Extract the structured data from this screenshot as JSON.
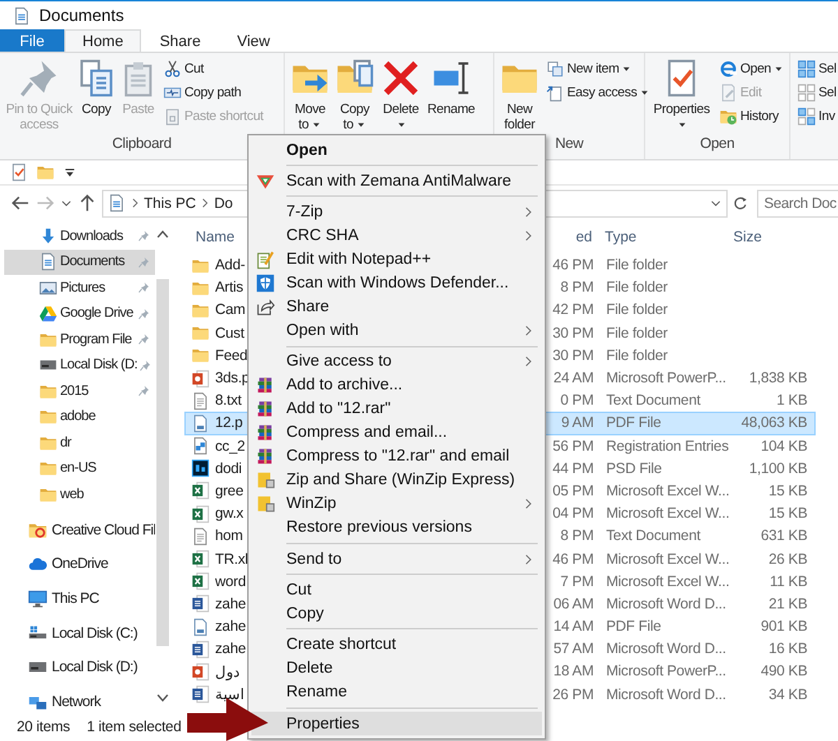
{
  "window": {
    "title": "Documents"
  },
  "ribbon_tabs": [
    {
      "label": "File",
      "kind": "file",
      "selected": false
    },
    {
      "label": "Home",
      "kind": "tab",
      "selected": true
    },
    {
      "label": "Share",
      "kind": "tab",
      "selected": false
    },
    {
      "label": "View",
      "kind": "tab",
      "selected": false
    }
  ],
  "ribbon_groups": [
    {
      "label": "Clipboard",
      "items": [
        {
          "kind": "large",
          "label": "Pin to Quick access",
          "disabled": true,
          "dropdown": false
        },
        {
          "kind": "large",
          "label": "Copy",
          "disabled": false,
          "dropdown": false
        },
        {
          "kind": "large",
          "label": "Paste",
          "disabled": true,
          "dropdown": false
        },
        {
          "kind": "stack",
          "items": [
            {
              "label": "Cut",
              "disabled": false,
              "dropdown": false
            },
            {
              "label": "Copy path",
              "disabled": false,
              "dropdown": false
            },
            {
              "label": "Paste shortcut",
              "disabled": true,
              "dropdown": false
            }
          ]
        }
      ]
    },
    {
      "items": [
        {
          "kind": "large",
          "label": "Move to",
          "disabled": false,
          "dropdown": true
        },
        {
          "kind": "large",
          "label": "Copy to",
          "disabled": false,
          "dropdown": true
        },
        {
          "kind": "large",
          "label": "Delete",
          "disabled": false,
          "dropdown": true
        },
        {
          "kind": "large",
          "label": "Rename",
          "disabled": false,
          "dropdown": false
        }
      ]
    },
    {
      "label": "New",
      "items": [
        {
          "kind": "large",
          "label": "New folder",
          "disabled": false,
          "dropdown": false
        },
        {
          "kind": "stack",
          "items": [
            {
              "label": "New item",
              "disabled": false,
              "dropdown": true
            },
            {
              "label": "Easy access",
              "disabled": false,
              "dropdown": true
            }
          ]
        }
      ]
    },
    {
      "label": "Open",
      "items": [
        {
          "kind": "large",
          "label": "Properties",
          "disabled": false,
          "dropdown": true
        },
        {
          "kind": "stack",
          "items": [
            {
              "label": "Open",
              "disabled": false,
              "dropdown": true
            },
            {
              "label": "Edit",
              "disabled": true,
              "dropdown": false
            },
            {
              "label": "History",
              "disabled": false,
              "dropdown": false
            }
          ]
        }
      ]
    },
    {
      "items": [
        {
          "kind": "stack",
          "items": [
            {
              "label": "Sel",
              "disabled": false,
              "dropdown": false
            },
            {
              "label": "Sel",
              "disabled": false,
              "dropdown": false
            },
            {
              "label": "Inv",
              "disabled": false,
              "dropdown": false
            }
          ]
        }
      ]
    }
  ],
  "address_bar": {
    "path": [
      "This PC",
      "Do"
    ]
  },
  "search": {
    "placeholder": "Search Doc"
  },
  "quick_access_items": [
    {
      "label": "Downloads",
      "pinned": true,
      "selected": false
    },
    {
      "label": "Documents",
      "pinned": true,
      "selected": true
    },
    {
      "label": "Pictures",
      "pinned": true,
      "selected": false
    },
    {
      "label": "Google Drive",
      "pinned": true,
      "selected": false
    },
    {
      "label": "Program File",
      "pinned": true,
      "selected": false
    },
    {
      "label": "Local Disk (D:",
      "pinned": true,
      "selected": false
    },
    {
      "label": "2015",
      "pinned": true,
      "selected": false
    },
    {
      "label": "adobe",
      "pinned": false,
      "selected": false
    },
    {
      "label": "dr",
      "pinned": false,
      "selected": false
    },
    {
      "label": "en-US",
      "pinned": false,
      "selected": false
    },
    {
      "label": "web",
      "pinned": false,
      "selected": false
    }
  ],
  "nav_items": [
    {
      "label": "Creative Cloud Fil",
      "selected": false
    },
    {
      "label": "OneDrive",
      "selected": false
    },
    {
      "label": "This PC",
      "selected": false
    },
    {
      "label": "Local Disk (C:)",
      "selected": false
    },
    {
      "label": "Local Disk (D:)",
      "selected": false
    },
    {
      "label": "Network",
      "selected": false
    }
  ],
  "file_list": {
    "columns": [
      "Name",
      "ed",
      "Type",
      "Size"
    ],
    "rows": [
      {
        "name": "Add-",
        "date": "46 PM",
        "type": "File folder",
        "selected": false
      },
      {
        "name": "Artis",
        "date": "8 PM",
        "type": "File folder",
        "selected": false
      },
      {
        "name": "Cam",
        "date": "42 PM",
        "type": "File folder",
        "selected": false
      },
      {
        "name": "Cust",
        "date": "30 PM",
        "type": "File folder",
        "selected": false
      },
      {
        "name": "Feed",
        "date": "30 PM",
        "type": "File folder",
        "selected": false
      },
      {
        "name": "3ds.p",
        "date": "24 AM",
        "type": "Microsoft PowerP...",
        "size": "1,838 KB",
        "selected": false
      },
      {
        "name": "8.txt",
        "date": "0 PM",
        "type": "Text Document",
        "size": "1 KB",
        "selected": false
      },
      {
        "name": "12.p",
        "date": "9 AM",
        "type": "PDF File",
        "size": "48,063 KB",
        "selected": true
      },
      {
        "name": "cc_2",
        "date": "56 PM",
        "type": "Registration Entries",
        "size": "104 KB",
        "selected": false
      },
      {
        "name": "dodi",
        "date": "44 PM",
        "type": "PSD File",
        "size": "1,100 KB",
        "selected": false
      },
      {
        "name": "gree",
        "date": "05 PM",
        "type": "Microsoft Excel W...",
        "size": "15 KB",
        "selected": false
      },
      {
        "name": "gw.x",
        "date": "04 PM",
        "type": "Microsoft Excel W...",
        "size": "15 KB",
        "selected": false
      },
      {
        "name": "hom",
        "date": "8 PM",
        "type": "Text Document",
        "size": "631 KB",
        "selected": false
      },
      {
        "name": "TR.xl",
        "date": "46 PM",
        "type": "Microsoft Excel W...",
        "size": "26 KB",
        "selected": false
      },
      {
        "name": "word",
        "date": "7 PM",
        "type": "Microsoft Excel W...",
        "size": "11 KB",
        "selected": false
      },
      {
        "name": "zahe",
        "date": "06 AM",
        "type": "Microsoft Word D...",
        "size": "21 KB",
        "selected": false
      },
      {
        "name": "zahe",
        "date": "14 AM",
        "type": "PDF File",
        "size": "901 KB",
        "selected": false
      },
      {
        "name": "zahe",
        "date": "57 AM",
        "type": "Microsoft Word D...",
        "size": "16 KB",
        "selected": false
      },
      {
        "name": "دول",
        "date": "18 AM",
        "type": "Microsoft PowerP...",
        "size": "490 KB",
        "selected": false
      },
      {
        "name": "اسية",
        "date": "26 PM",
        "type": "Microsoft Word D...",
        "size": "34 KB",
        "selected": false
      }
    ]
  },
  "status_bar": {
    "count": "20 items",
    "selection": "1 item selected"
  },
  "context_menu": {
    "items": [
      {
        "kind": "item",
        "label": "Open",
        "default": true,
        "submenu": false,
        "selected": false
      },
      {
        "kind": "separator"
      },
      {
        "kind": "item",
        "label": "Scan with Zemana AntiMalware",
        "default": false,
        "submenu": false,
        "selected": false
      },
      {
        "kind": "separator"
      },
      {
        "kind": "item",
        "label": "7-Zip",
        "default": false,
        "submenu": true,
        "selected": false
      },
      {
        "kind": "item",
        "label": "CRC SHA",
        "default": false,
        "submenu": true,
        "selected": false
      },
      {
        "kind": "item",
        "label": "Edit with Notepad++",
        "default": false,
        "submenu": false,
        "selected": false
      },
      {
        "kind": "item",
        "label": "Scan with Windows Defender...",
        "default": false,
        "submenu": false,
        "selected": false
      },
      {
        "kind": "item",
        "label": "Share",
        "default": false,
        "submenu": false,
        "selected": false
      },
      {
        "kind": "item",
        "label": "Open with",
        "default": false,
        "submenu": true,
        "selected": false
      },
      {
        "kind": "separator"
      },
      {
        "kind": "item",
        "label": "Give access to",
        "default": false,
        "submenu": true,
        "selected": false
      },
      {
        "kind": "item",
        "label": "Add to archive...",
        "default": false,
        "submenu": false,
        "selected": false
      },
      {
        "kind": "item",
        "label": "Add to \"12.rar\"",
        "default": false,
        "submenu": false,
        "selected": false
      },
      {
        "kind": "item",
        "label": "Compress and email...",
        "default": false,
        "submenu": false,
        "selected": false
      },
      {
        "kind": "item",
        "label": "Compress to \"12.rar\" and email",
        "default": false,
        "submenu": false,
        "selected": false
      },
      {
        "kind": "item",
        "label": "Zip and Share (WinZip Express)",
        "default": false,
        "submenu": false,
        "selected": false
      },
      {
        "kind": "item",
        "label": "WinZip",
        "default": false,
        "submenu": true,
        "selected": false
      },
      {
        "kind": "item",
        "label": "Restore previous versions",
        "default": false,
        "submenu": false,
        "selected": false
      },
      {
        "kind": "separator"
      },
      {
        "kind": "item",
        "label": "Send to",
        "default": false,
        "submenu": true,
        "selected": false
      },
      {
        "kind": "separator"
      },
      {
        "kind": "item",
        "label": "Cut",
        "default": false,
        "submenu": false,
        "selected": false
      },
      {
        "kind": "item",
        "label": "Copy",
        "default": false,
        "submenu": false,
        "selected": false
      },
      {
        "kind": "separator"
      },
      {
        "kind": "item",
        "label": "Create shortcut",
        "default": false,
        "submenu": false,
        "selected": false
      },
      {
        "kind": "item",
        "label": "Delete",
        "default": false,
        "submenu": false,
        "selected": false
      },
      {
        "kind": "item",
        "label": "Rename",
        "default": false,
        "submenu": false,
        "selected": false
      },
      {
        "kind": "separator"
      },
      {
        "kind": "item",
        "label": "Properties",
        "default": false,
        "submenu": false,
        "selected": true
      }
    ]
  }
}
